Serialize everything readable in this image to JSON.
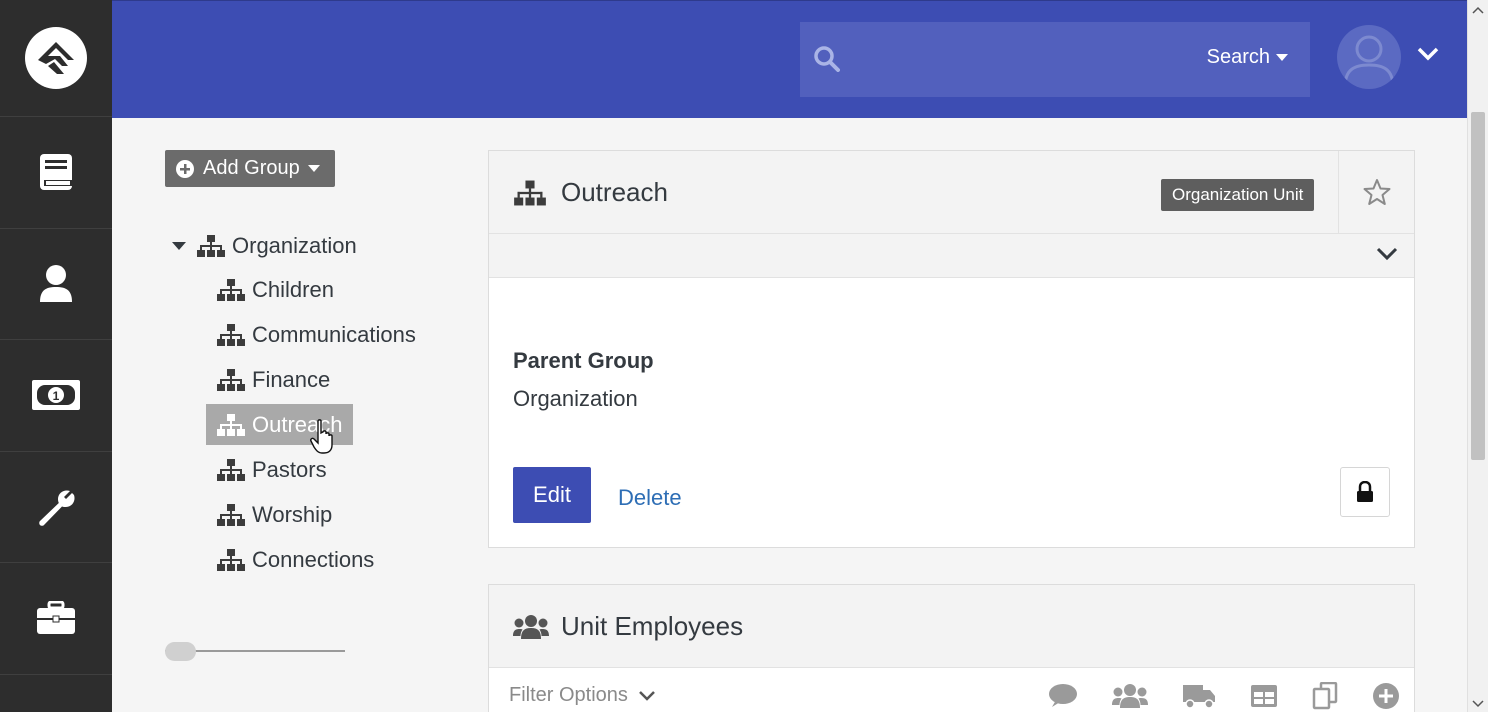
{
  "rail": {
    "items": [
      {
        "icon": "book-icon"
      },
      {
        "icon": "person-icon"
      },
      {
        "icon": "money-icon"
      },
      {
        "icon": "wrench-icon"
      },
      {
        "icon": "briefcase-icon"
      }
    ]
  },
  "header": {
    "search": {
      "placeholder": "",
      "button_label": "Search"
    }
  },
  "tree": {
    "add_group_label": "Add Group",
    "root": "Organization",
    "children": [
      "Children",
      "Communications",
      "Finance",
      "Outreach",
      "Pastors",
      "Worship",
      "Connections"
    ],
    "selected": "Outreach"
  },
  "group_card": {
    "title": "Outreach",
    "badge": "Organization Unit",
    "parent_label": "Parent Group",
    "parent_value": "Organization",
    "edit_label": "Edit",
    "delete_label": "Delete"
  },
  "members_card": {
    "title": "Unit Employees",
    "filter_label": "Filter Options"
  },
  "colors": {
    "header": "#3d4db3",
    "rail": "#2d2d2d",
    "primary_button": "#3d4db3",
    "link": "#2e6eb5",
    "badge": "#5e5e5e"
  }
}
